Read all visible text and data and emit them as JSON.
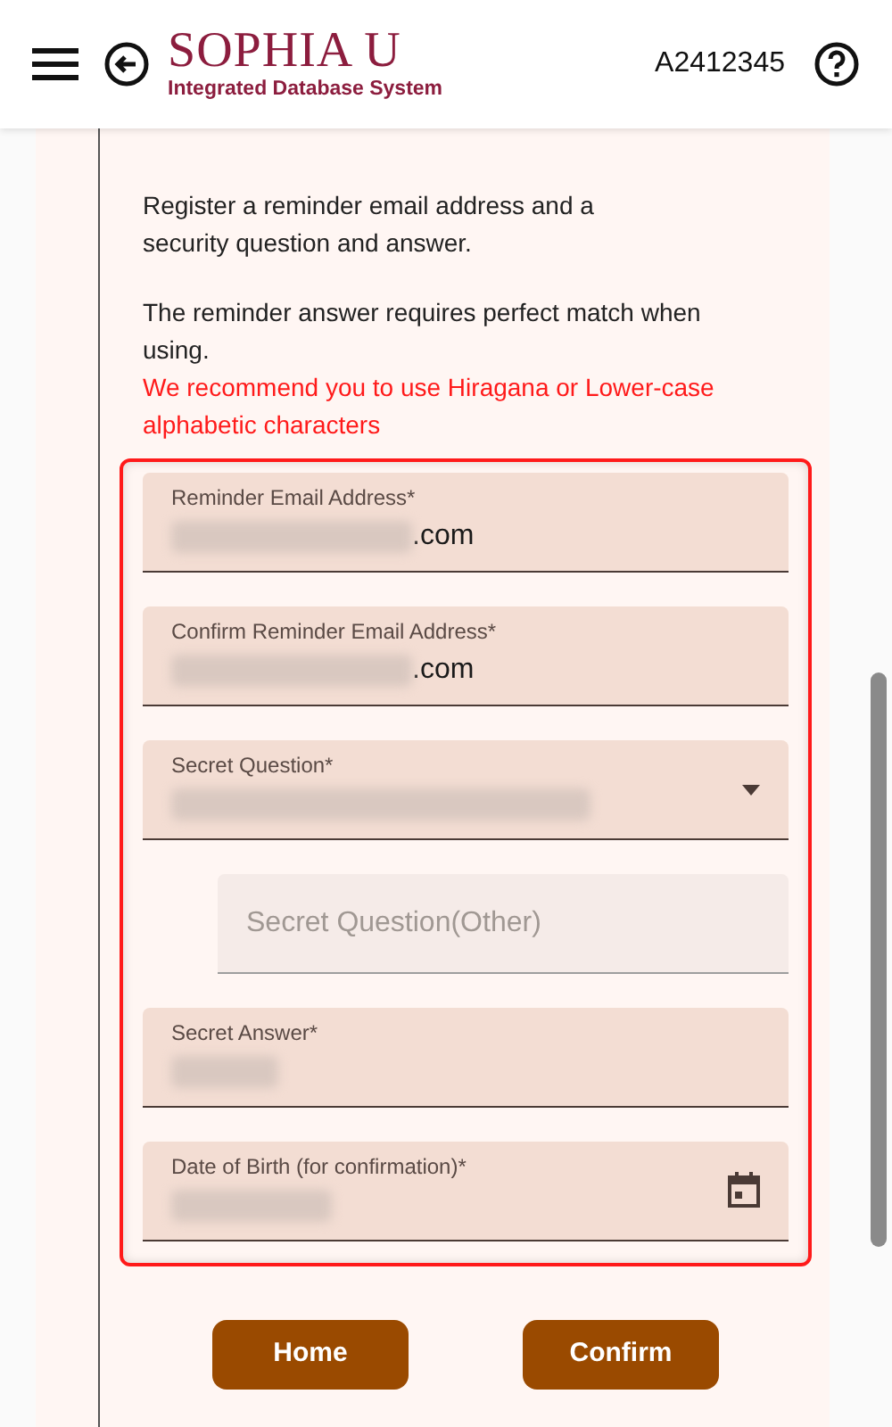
{
  "header": {
    "logo_title": "SOPHIA U",
    "logo_subtitle": "Integrated Database System",
    "user_id": "A2412345"
  },
  "intro": [
    "Register a reminder email address and a security question and answer.",
    "The reminder answer requires perfect match when using."
  ],
  "warning": "We recommend you to use Hiragana or Lower-case alphabetic characters",
  "fields": [
    {
      "kind": "text",
      "label": "Reminder Email Address*",
      "value": ".com",
      "redacted": true
    },
    {
      "kind": "text",
      "label": "Confirm Reminder Email Address*",
      "value": ".com",
      "redacted": true
    },
    {
      "kind": "select",
      "label": "Secret Question*",
      "redacted": true
    },
    {
      "kind": "other",
      "placeholder": "Secret Question(Other)"
    },
    {
      "kind": "text",
      "label": "Secret Answer*",
      "redacted": true
    },
    {
      "kind": "date",
      "label": "Date of Birth (for confirmation)*",
      "redacted": true
    }
  ],
  "buttons": [
    "Home",
    "Confirm"
  ]
}
